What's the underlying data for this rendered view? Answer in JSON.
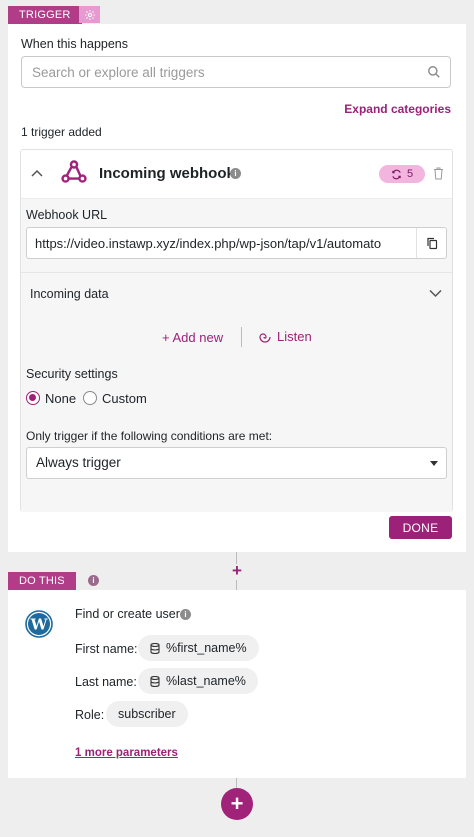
{
  "trigger_section": {
    "tag": "TRIGGER",
    "when_label": "When this happens",
    "search_placeholder": "Search or explore all triggers",
    "expand_link": "Expand categories",
    "added_count": "1 trigger added",
    "trigger": {
      "name": "Incoming webhook",
      "badge_count": "5",
      "webhook_url_label": "Webhook URL",
      "webhook_url_value": "https://video.instawp.xyz/index.php/wp-json/tap/v1/automato",
      "incoming_data_label": "Incoming data",
      "add_new_label": "+ Add new",
      "listen_label": "Listen",
      "security_label": "Security settings",
      "security_options": [
        "None",
        "Custom"
      ],
      "security_selected": "None",
      "conditions_label": "Only trigger if the following conditions are met:",
      "conditions_value": "Always trigger"
    },
    "done_label": "DONE"
  },
  "action_section": {
    "tag": "DO THIS",
    "action_title": "Find or create user",
    "fields": [
      {
        "label": "First name:",
        "value": "%first_name%"
      },
      {
        "label": "Last name:",
        "value": "%last_name%"
      },
      {
        "label": "Role:",
        "value": "subscriber"
      }
    ],
    "more_params_link": "1 more parameters"
  },
  "colors": {
    "accent": "#9b2278",
    "tag_bg": "#b13d88",
    "badge_bg": "#f2b5dd"
  },
  "icons": [
    "settings-gear-icon",
    "search-icon",
    "chevron-up-icon",
    "webhook-icon",
    "info-icon",
    "refresh-icon",
    "trash-icon",
    "copy-icon",
    "chevron-down-icon",
    "listen-icon",
    "wordpress-icon",
    "database-icon",
    "plus-icon"
  ]
}
